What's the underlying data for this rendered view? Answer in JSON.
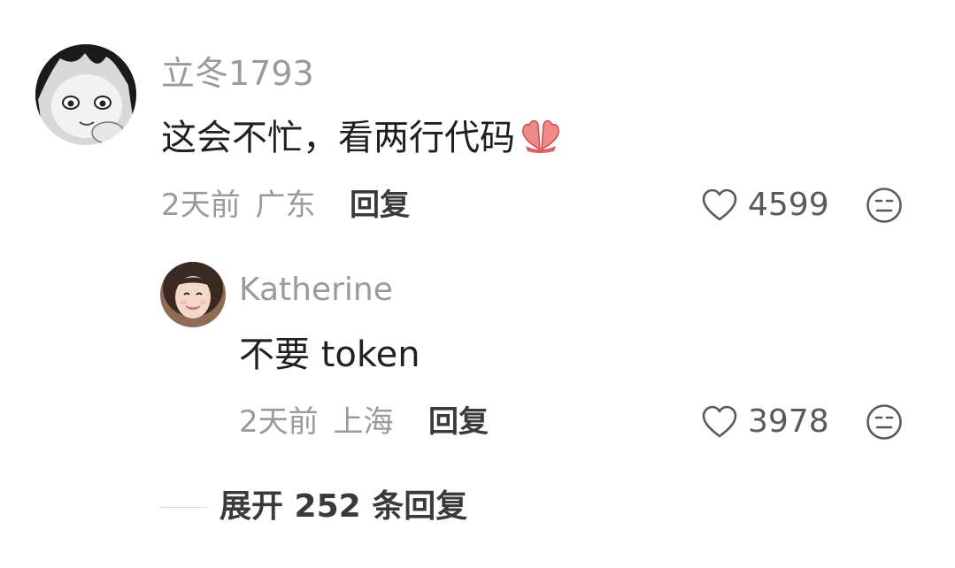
{
  "comment": {
    "username": "立冬1793",
    "text": "这会不忙，看两行代码",
    "emoji_icon": "folded-hands-icon",
    "time": "2天前",
    "location": "广东",
    "reply_label": "回复",
    "like_count": "4599"
  },
  "reply": {
    "username": "Katherine",
    "text": "不要 token",
    "time": "2天前",
    "location": "上海",
    "reply_label": "回复",
    "like_count": "3978"
  },
  "expand": {
    "label": "展开 252 条回复"
  },
  "colors": {
    "meta_gray": "#9a9a9a",
    "text_dark": "#1f1f1f",
    "action_dark": "#3a3a3a"
  }
}
